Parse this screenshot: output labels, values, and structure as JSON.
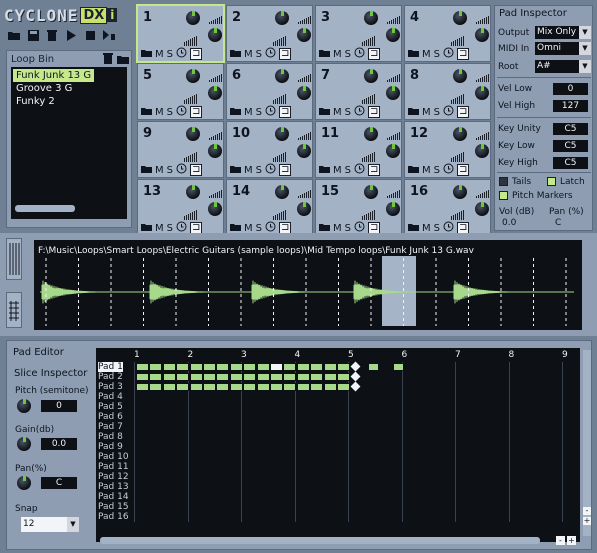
{
  "header": {
    "logo_text": "CYCLONE",
    "logo_dx": "DX",
    "logo_i": "i"
  },
  "toolbar": {
    "icons": [
      "folder-open-icon",
      "save-icon",
      "trash-icon",
      "play-icon",
      "stop-icon",
      "export-icon"
    ]
  },
  "loop_bin": {
    "title": "Loop Bin",
    "items": [
      {
        "label": "Funk Junk 13 G",
        "selected": true
      },
      {
        "label": "Groove 3 G",
        "selected": false
      },
      {
        "label": "Funky 2",
        "selected": false
      }
    ]
  },
  "pads": [
    {
      "number": "1",
      "active": true
    },
    {
      "number": "2"
    },
    {
      "number": "3"
    },
    {
      "number": "4"
    },
    {
      "number": "5"
    },
    {
      "number": "6"
    },
    {
      "number": "7"
    },
    {
      "number": "8"
    },
    {
      "number": "9"
    },
    {
      "number": "10"
    },
    {
      "number": "11"
    },
    {
      "number": "12"
    },
    {
      "number": "13"
    },
    {
      "number": "14"
    },
    {
      "number": "15"
    },
    {
      "number": "16"
    }
  ],
  "pad_buttons": {
    "mute": "M",
    "solo": "S"
  },
  "inspector": {
    "title": "Pad Inspector",
    "output_label": "Output",
    "output_value": "Mix Only",
    "midi_label": "MIDI In",
    "midi_value": "Omni",
    "root_label": "Root",
    "root_value": "A#",
    "vel_low_label": "Vel Low",
    "vel_low_value": "0",
    "vel_high_label": "Vel High",
    "vel_high_value": "127",
    "key_unity_label": "Key Unity",
    "key_unity_value": "C5",
    "key_low_label": "Key Low",
    "key_low_value": "C5",
    "key_high_label": "Key High",
    "key_high_value": "C5",
    "tails_label": "Tails",
    "latch_label": "Latch",
    "pitch_markers_label": "Pitch Markers",
    "vol_label": "Vol (dB)",
    "vol_value": "0.0",
    "pan_label": "Pan (%)",
    "pan_value": "C"
  },
  "waveform": {
    "path": "F:\\Music\\Loops\\Smart Loops\\Electric Guitars (sample loops)\\Mid Tempo loops\\Funk Junk 13 G.wav"
  },
  "pad_editor": {
    "title": "Pad Editor",
    "slice_inspector_title": "Slice Inspector",
    "pitch_label": "Pitch (semitone)",
    "pitch_value": "0",
    "gain_label": "Gain(db)",
    "gain_value": "0.0",
    "pan_label": "Pan(%)",
    "pan_value": "C",
    "snap_label": "Snap",
    "snap_value": "12",
    "ruler": [
      "1",
      "2",
      "3",
      "4",
      "5",
      "6",
      "7",
      "8",
      "9"
    ],
    "rows": [
      "Pad 1",
      "Pad 2",
      "Pad 3",
      "Pad 4",
      "Pad 5",
      "Pad 6",
      "Pad 7",
      "Pad 8",
      "Pad 9",
      "Pad 10",
      "Pad 11",
      "Pad 12",
      "Pad 13",
      "Pad 14",
      "Pad 15",
      "Pad 16"
    ],
    "selected_row": "Pad 1"
  },
  "colors": {
    "accent": "#c5e88a",
    "knob_indicator": "#6ec83e",
    "background": "#6f7f94"
  }
}
